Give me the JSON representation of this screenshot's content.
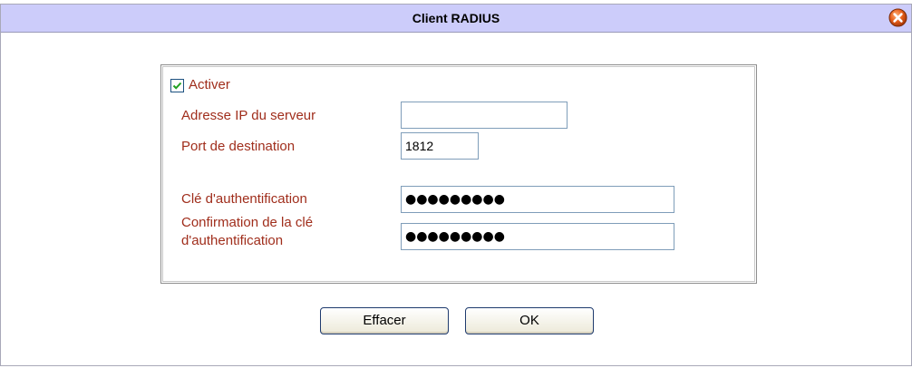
{
  "dialog": {
    "title": "Client RADIUS",
    "close_icon": "close-icon",
    "accent_color": "#ccccfa"
  },
  "form": {
    "enable": {
      "label": "Activer",
      "checked": true
    },
    "server_ip": {
      "label": "Adresse IP du serveur",
      "value": ""
    },
    "dest_port": {
      "label": "Port de destination",
      "value": "1812"
    },
    "auth_key": {
      "label": "Clé d'authentification",
      "value": "●●●●●●●●●"
    },
    "confirm_key": {
      "label_line1": "Confirmation de la clé",
      "label_line2": "d'authentification",
      "value": "●●●●●●●●●"
    },
    "label_color": "#a02e1c"
  },
  "buttons": {
    "clear_label": "Effacer",
    "ok_label": "OK"
  }
}
